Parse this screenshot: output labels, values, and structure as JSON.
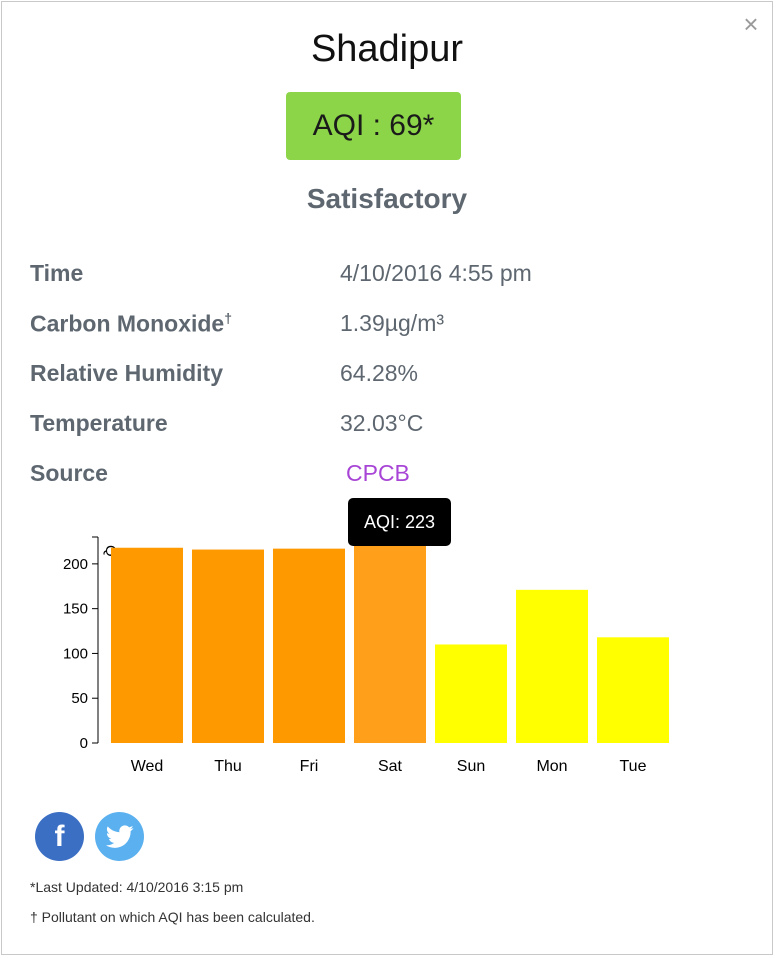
{
  "popup": {
    "close_symbol": "×",
    "title": "Shadipur",
    "aqi_badge": {
      "text": "AQI : 69*",
      "color": "#8cd448"
    },
    "category": "Satisfactory",
    "details": [
      {
        "label": "Time",
        "value": "4/10/2016 4:55 pm"
      },
      {
        "label": "Carbon Monoxide",
        "label_sup": "†",
        "value": "1.39µg/m³"
      },
      {
        "label": "Relative Humidity",
        "value": "64.28%"
      },
      {
        "label": "Temperature",
        "value": "32.03°C"
      },
      {
        "label": "Source",
        "value": "CPCB",
        "value_color": "#a845d6"
      }
    ]
  },
  "chart_data": {
    "type": "bar",
    "categories": [
      "Wed",
      "Thu",
      "Fri",
      "Sat",
      "Sun",
      "Mon",
      "Tue"
    ],
    "values": [
      218,
      216,
      217,
      223,
      110,
      171,
      118
    ],
    "bar_colors": [
      "#ff9900",
      "#ff9900",
      "#ff9900",
      "#ff9f1a",
      "#ffff00",
      "#ffff00",
      "#ffff00"
    ],
    "ylim": [
      0,
      230
    ],
    "yticks": [
      0,
      50,
      100,
      150,
      200
    ],
    "ylabel_partial": "Q",
    "tooltip": "AQI: 223",
    "grid": false
  },
  "social": {
    "facebook": {
      "icon": "facebook-icon",
      "color": "#3b6fc4",
      "glyph": "f"
    },
    "twitter": {
      "icon": "twitter-icon",
      "color": "#5bb0ef"
    }
  },
  "footnotes": {
    "last_updated": "*Last Updated: 4/10/2016 3:15 pm",
    "pollutant_note": "† Pollutant on which AQI has been calculated."
  }
}
